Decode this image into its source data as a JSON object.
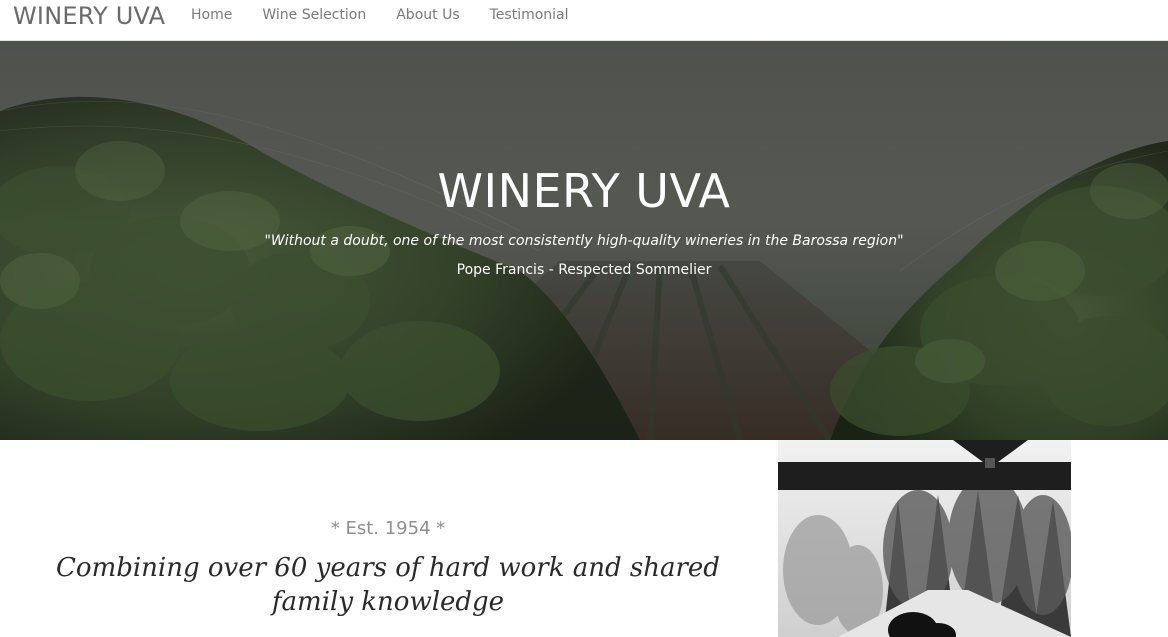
{
  "navbar": {
    "brand": "WINERY UVA",
    "links": [
      "Home",
      "Wine Selection",
      "About Us",
      "Testimonial"
    ]
  },
  "hero": {
    "title": "WINERY UVA",
    "quote": "\"Without a doubt, one of the most consistently high-quality wineries in the Barossa region\"",
    "attribution": "Pope Francis - Respected Sommelier"
  },
  "about": {
    "established": "* Est. 1954 *",
    "tagline": "Combining over 60 years of hard work and shared family knowledge"
  },
  "colors": {
    "brand_text": "#6b6b6b",
    "nav_text": "#7a7a7a",
    "hero_text": "#ffffff",
    "est_text": "#8f8f8f",
    "tagline_text": "#2a2a2a"
  }
}
